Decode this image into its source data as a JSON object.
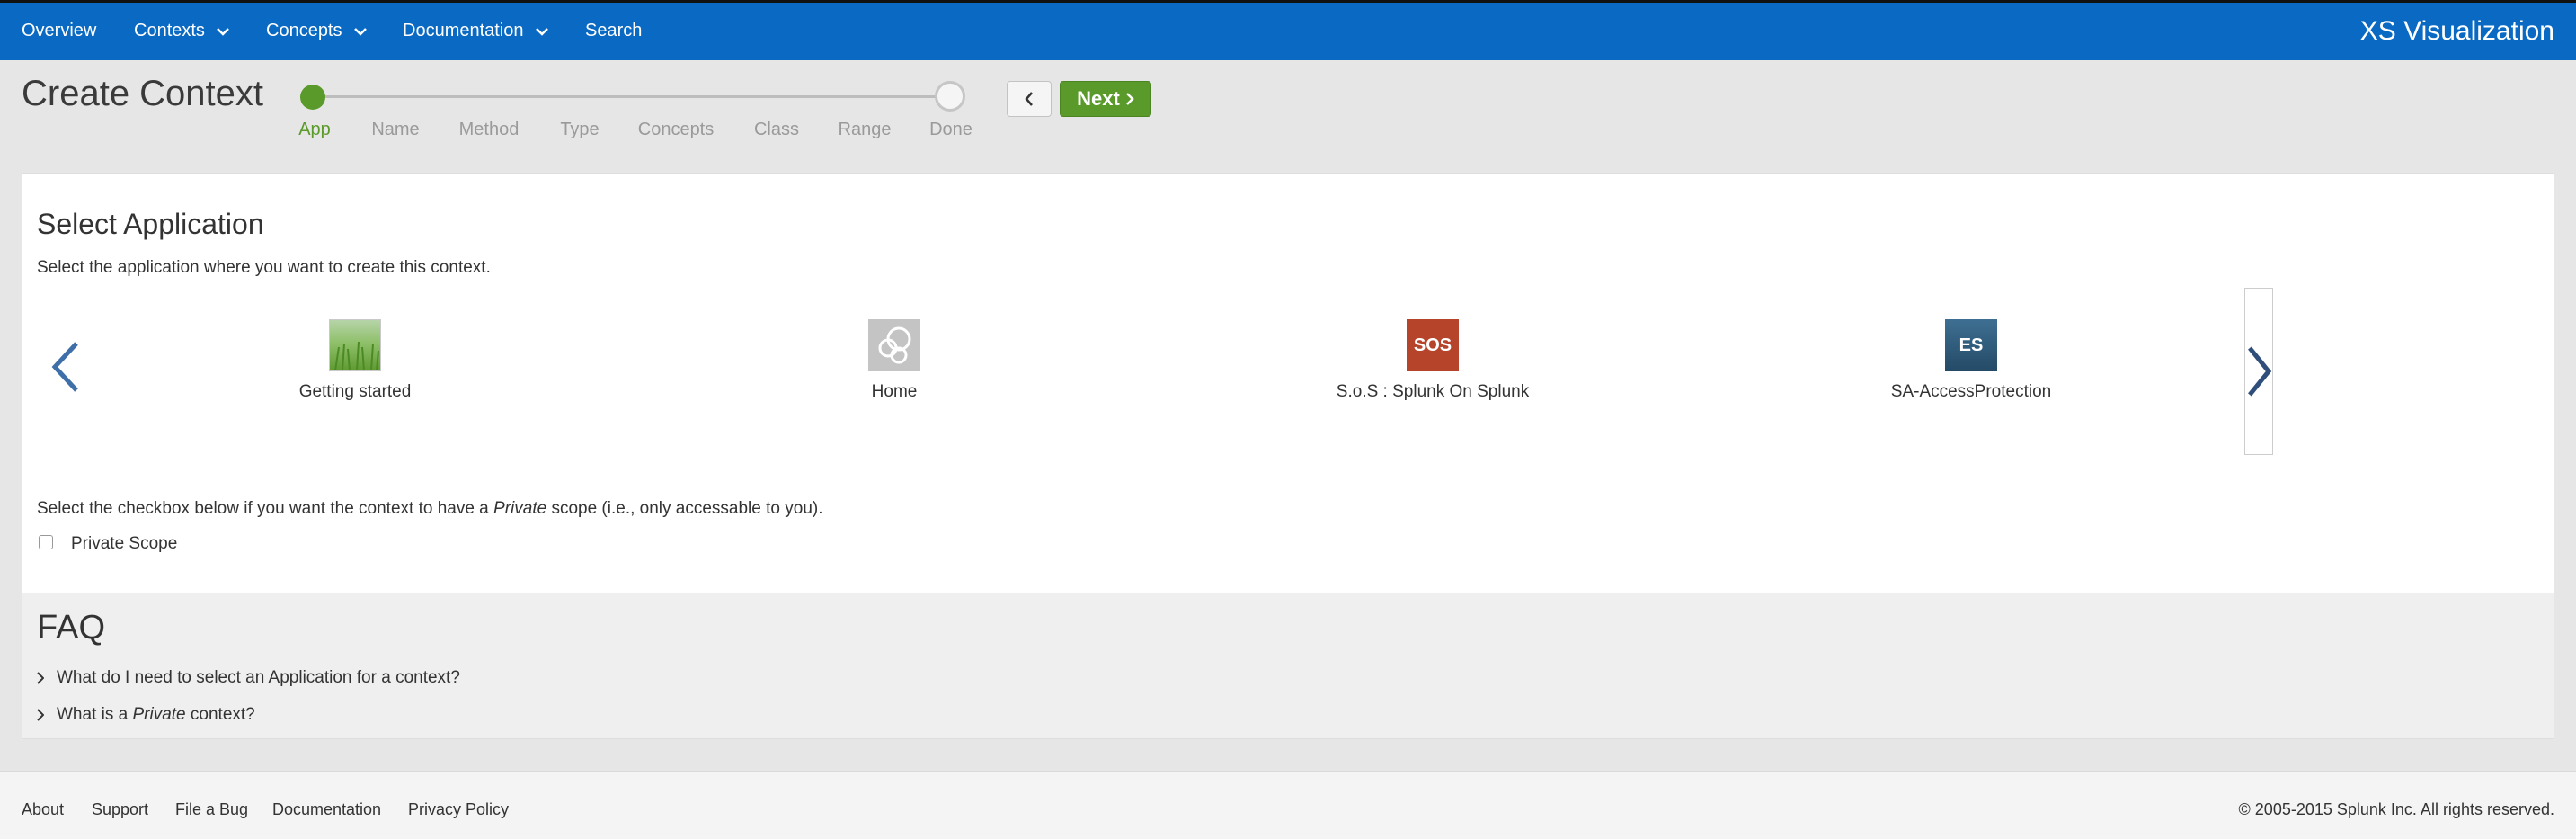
{
  "nav": {
    "items": [
      {
        "label": "Overview",
        "dropdown": false
      },
      {
        "label": "Contexts",
        "dropdown": true
      },
      {
        "label": "Concepts",
        "dropdown": true
      },
      {
        "label": "Documentation",
        "dropdown": true
      },
      {
        "label": "Search",
        "dropdown": false
      }
    ],
    "brand": "XS Visualization",
    "bar_color": "#0a69c2"
  },
  "header": {
    "title": "Create Context",
    "steps": [
      "App",
      "Name",
      "Method",
      "Type",
      "Concepts",
      "Class",
      "Range",
      "Done"
    ],
    "current_step": "App",
    "next_label": "Next",
    "accent_color": "#5a9a2a"
  },
  "select_app": {
    "title": "Select Application",
    "description": "Select the application where you want to create this context.",
    "apps": [
      {
        "name": "Getting started",
        "icon": "grass-icon"
      },
      {
        "name": "Home",
        "icon": "circles-icon"
      },
      {
        "name": "S.o.S : Splunk On Splunk",
        "icon": "sos-icon",
        "icon_text": "SOS",
        "color": "#b5442a"
      },
      {
        "name": "SA-AccessProtection",
        "icon": "es-icon",
        "icon_text": "ES",
        "color": "#2f5a7a"
      }
    ],
    "scope_text_before": "Select the checkbox below if you want the context to have a ",
    "scope_text_em": "Private",
    "scope_text_after": " scope (i.e., only accessable to you).",
    "private_scope_label": "Private Scope",
    "private_scope_checked": false
  },
  "faq": {
    "title": "FAQ",
    "q1": "What do I need to select an Application for a context?",
    "q2_before": "What is a ",
    "q2_em": "Private",
    "q2_after": " context?"
  },
  "footer": {
    "links": [
      "About",
      "Support",
      "File a Bug",
      "Documentation",
      "Privacy Policy"
    ],
    "copyright": "© 2005-2015 Splunk Inc. All rights reserved."
  }
}
